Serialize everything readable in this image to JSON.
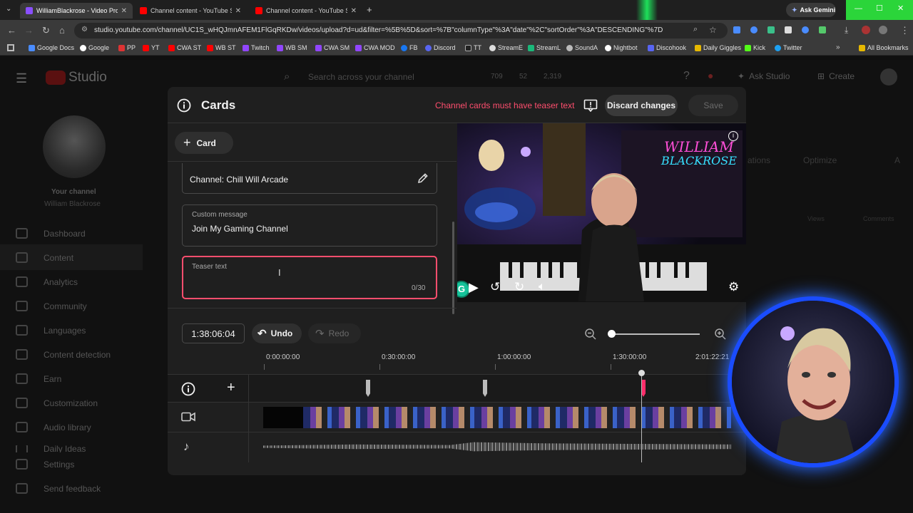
{
  "browser": {
    "tabs": [
      {
        "label": "WilliamBlackrose - Video Prod",
        "active": true,
        "color": "#8a4fff"
      },
      {
        "label": "Channel content - YouTube St",
        "active": false,
        "color": "#ff0000"
      },
      {
        "label": "Channel content - YouTube St",
        "active": false,
        "color": "#ff0000"
      }
    ],
    "ask_gemini": "Ask Gemini",
    "url": "studio.youtube.com/channel/UC1S_wHQJmnAFEM1FlGqRKDw/videos/upload?d=ud&filter=%5B%5D&sort=%7B\"columnType\"%3A\"date\"%2C\"sortOrder\"%3A\"DESCENDING\"%7D",
    "bookmarks": [
      "Google Docs",
      "Google",
      "PP",
      "YT",
      "CWA ST",
      "WB ST",
      "Twitch",
      "WB SM",
      "CWA SM",
      "CWA MOD",
      "FB",
      "Discord",
      "TT",
      "StreamE",
      "StreamL",
      "SoundA",
      "Nightbot",
      "Discohook",
      "Daily Giggles",
      "Kick",
      "Twitter"
    ],
    "all_bookmarks": "All Bookmarks"
  },
  "studio": {
    "logo_text": "Studio",
    "search_placeholder": "Search across your channel",
    "stats": [
      "709",
      "52",
      "2,319"
    ],
    "ask_studio": "Ask Studio",
    "create": "Create",
    "your_channel": "Your channel",
    "channel_name": "William Blackrose",
    "nav": [
      "Dashboard",
      "Content",
      "Analytics",
      "Community",
      "Languages",
      "Content detection",
      "Earn",
      "Customization",
      "Audio library",
      "Daily Ideas"
    ],
    "settings": "Settings",
    "feedback": "Send feedback",
    "bg_tabs": [
      "ations",
      "Optimize",
      "A"
    ],
    "bg_cols": [
      "Views",
      "Comments"
    ]
  },
  "modal": {
    "title": "Cards",
    "error": "Channel cards must have teaser text",
    "discard": "Discard changes",
    "save": "Save",
    "add_card": "Card",
    "channel_field": "Channel: Chill Will Arcade",
    "custom_label": "Custom message",
    "custom_value": "Join My Gaming Channel",
    "teaser_label": "Teaser text",
    "teaser_counter": "0/30",
    "video_title_art": "WILLIAM BLACKROSE"
  },
  "timeline": {
    "timecode": "1:38:06:04",
    "undo": "Undo",
    "redo": "Redo",
    "ticks": [
      "0:00:00:00",
      "0:30:00:00",
      "1:00:00:00",
      "1:30:00:00",
      "2:01:22:21"
    ]
  }
}
